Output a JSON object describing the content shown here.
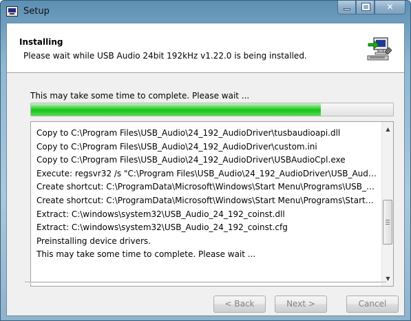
{
  "window": {
    "title": "Setup"
  },
  "header": {
    "title": "Installing",
    "subtitle": "Please wait while USB Audio 24bit 192kHz v1.22.0 is being installed."
  },
  "status": {
    "text": "This may take some time to complete. Please wait ...",
    "progress_percent": 80
  },
  "log": {
    "lines": [
      "Copy to C:\\Program Files\\USB_Audio\\24_192_AudioDriver\\tusbaudioapi.dll",
      "Copy to C:\\Program Files\\USB_Audio\\24_192_AudioDriver\\custom.ini",
      "Copy to C:\\Program Files\\USB_Audio\\24_192_AudioDriver\\USBAudioCpl.exe",
      "Execute: regsvr32 /s \"C:\\Program Files\\USB_Audio\\24_192_AudioDriver\\USB_Audio_...",
      "Create shortcut: C:\\ProgramData\\Microsoft\\Windows\\Start Menu\\Programs\\USB_Au...",
      "Create shortcut: C:\\ProgramData\\Microsoft\\Windows\\Start Menu\\Programs\\Startup\\...",
      "Extract: C:\\windows\\system32\\USB_Audio_24_192_coinst.dll",
      "Extract: C:\\windows\\system32\\USB_Audio_24_192_coinst.cfg",
      "Preinstalling device drivers.",
      "This may take some time to complete. Please wait ..."
    ]
  },
  "buttons": {
    "back": "< Back",
    "next": "Next >",
    "cancel": "Cancel"
  },
  "icons": {
    "app": "setup-app-icon",
    "header": "installer-computer-icon",
    "minimize": "minimize-icon",
    "maximize": "maximize-icon",
    "close": "close-icon"
  },
  "colors": {
    "progress": "#11c611",
    "disabled_text": "#838383"
  }
}
